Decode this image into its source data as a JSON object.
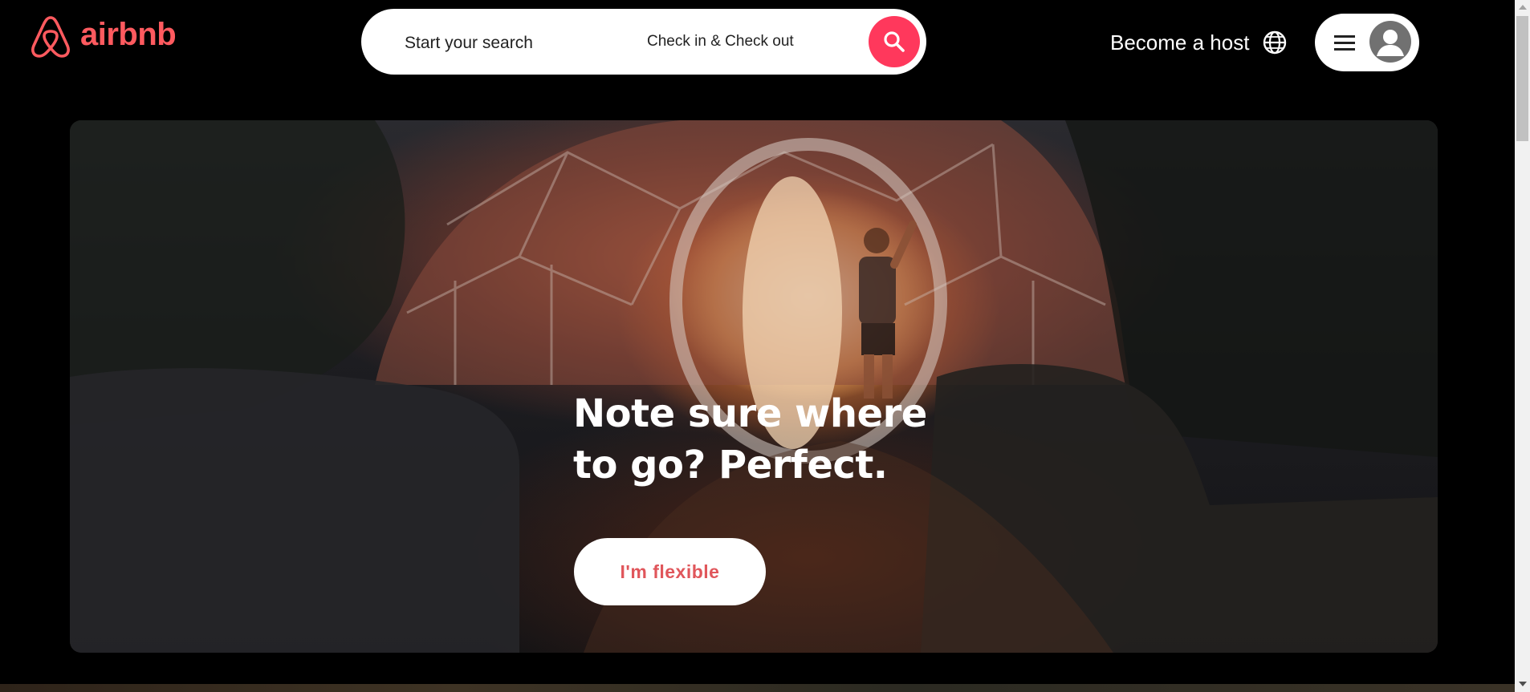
{
  "header": {
    "logo_text": "airbnb",
    "search": {
      "placeholder": "Start your search",
      "dates_label": "Check in & Check out"
    },
    "host_link": "Become a host",
    "globe_icon": "globe-icon",
    "menu_icon": "hamburger-menu-icon",
    "avatar_icon": "user-avatar-icon"
  },
  "hero": {
    "title": "Note sure where to go? Perfect.",
    "cta_label": "I'm flexible"
  },
  "colors": {
    "brand": "#ff5a5f",
    "search_button": "#ff385c",
    "background": "#000000",
    "cta_text": "#e0565b"
  }
}
